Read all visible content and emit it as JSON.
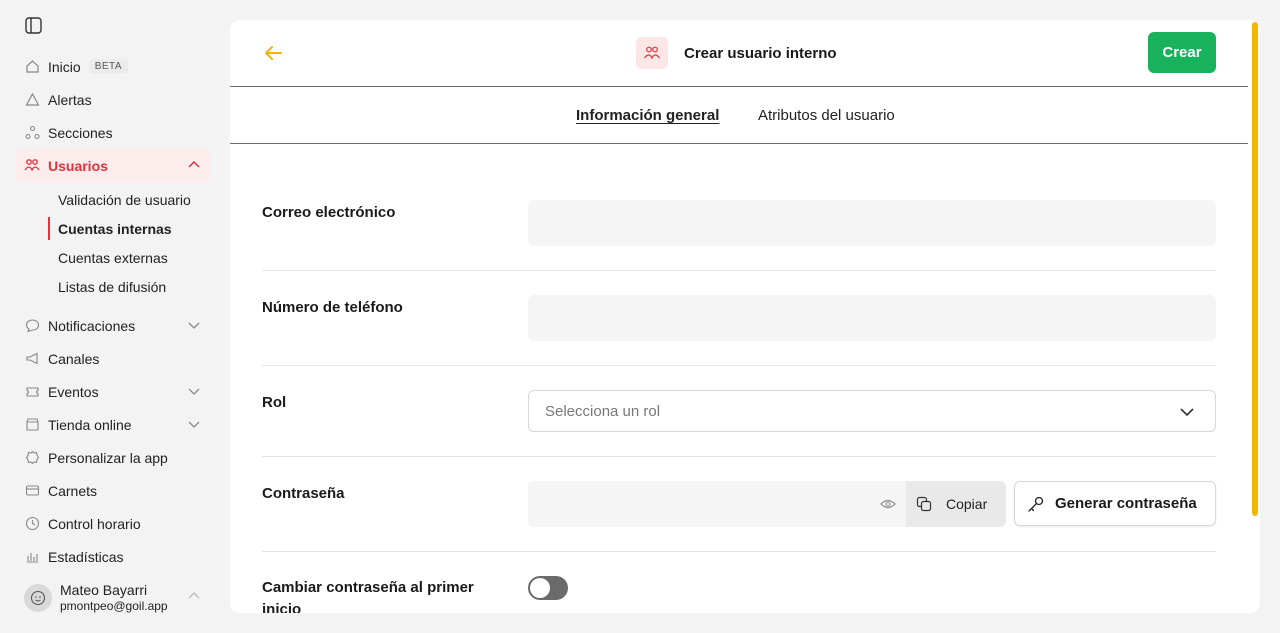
{
  "sidebar": {
    "items": [
      {
        "label": "Inicio",
        "badge": "BETA",
        "icon": "home-icon"
      },
      {
        "label": "Alertas",
        "icon": "alert-icon"
      },
      {
        "label": "Secciones",
        "icon": "sections-icon"
      },
      {
        "label": "Usuarios",
        "icon": "users-icon",
        "expanded": true
      },
      {
        "label": "Notificaciones",
        "icon": "chat-icon"
      },
      {
        "label": "Canales",
        "icon": "megaphone-icon"
      },
      {
        "label": "Eventos",
        "icon": "events-icon"
      },
      {
        "label": "Tienda online",
        "icon": "store-icon"
      },
      {
        "label": "Personalizar la app",
        "icon": "customize-icon"
      },
      {
        "label": "Carnets",
        "icon": "card-icon"
      },
      {
        "label": "Control horario",
        "icon": "clock-icon"
      },
      {
        "label": "Estadísticas",
        "icon": "stats-icon"
      }
    ],
    "users_sub": [
      {
        "label": "Validación de usuario"
      },
      {
        "label": "Cuentas internas"
      },
      {
        "label": "Cuentas externas"
      },
      {
        "label": "Listas de difusión"
      }
    ],
    "user": {
      "name": "Mateo Bayarri",
      "email": "pmontpeo@goil.app"
    }
  },
  "header": {
    "title": "Crear usuario interno",
    "create_label": "Crear"
  },
  "tabs": [
    {
      "label": "Información general"
    },
    {
      "label": "Atributos del usuario"
    }
  ],
  "form": {
    "email_label": "Correo electrónico",
    "email_value": "",
    "phone_label": "Número de teléfono",
    "phone_value": "",
    "role_label": "Rol",
    "role_placeholder": "Selecciona un rol",
    "password_label": "Contraseña",
    "copy_label": "Copiar",
    "generate_label": "Generar contraseña",
    "change_pw_label": "Cambiar contraseña al primer inicio"
  },
  "colors": {
    "accent": "#e2313a",
    "primary": "#18b25c",
    "scroll": "#f2b705",
    "back": "#f2b705"
  }
}
